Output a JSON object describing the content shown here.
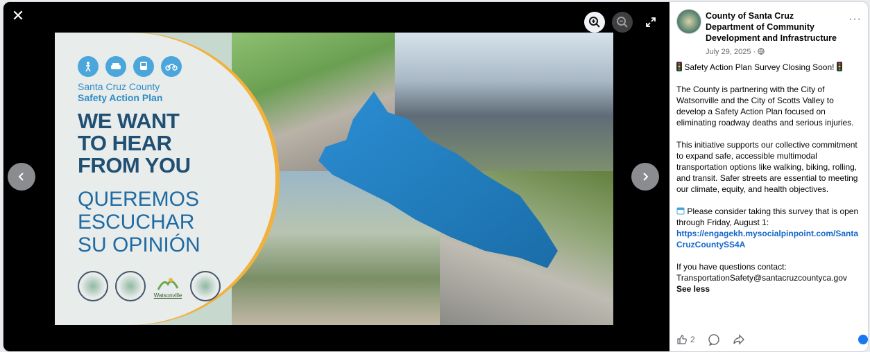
{
  "viewer": {
    "close_icon": "close-icon",
    "zoom_in_icon": "zoom-in-icon",
    "zoom_out_icon": "zoom-out-icon",
    "expand_icon": "expand-icon",
    "prev_icon": "chevron-left-icon",
    "next_icon": "chevron-right-icon"
  },
  "graphic": {
    "brand_line1": "Santa Cruz County",
    "brand_line2": "Safety Action Plan",
    "headline_line1": "WE WANT",
    "headline_line2": "TO HEAR",
    "headline_line3": "FROM YOU",
    "spanish_line1": "QUEREMOS",
    "spanish_line2": "ESCUCHAR",
    "spanish_line3": "SU OPINIÓN",
    "watsonville_label": "Watsonville",
    "colors": {
      "accent_blue": "#2e8cc9",
      "headline_navy": "#1f4f73",
      "orange": "#f2b13c"
    }
  },
  "post": {
    "author": "County of Santa Cruz Department of Community Development and Infrastructure",
    "date": "July 29, 2025 ·",
    "title": "Safety Action Plan Survey Closing Soon!",
    "paragraph1": "The County is partnering with the City of Watsonville and the City of Scotts Valley to develop a Safety Action Plan focused on eliminating roadway deaths and serious injuries.",
    "paragraph2": "This initiative supports our collective commitment to expand safe, accessible multimodal transportation options like walking, biking, rolling, and transit. Safer streets are essential to meeting our climate, equity, and health objectives.",
    "paragraph3": "Please consider taking this survey that is open through Friday, August 1:",
    "link": "https://engagekh.mysocialpinpoint.com/SantaCruzCountySS4A",
    "contact_label": "If you have questions contact:",
    "contact_email": "TransportationSafety@santacruzcountyca.gov",
    "see_less": "See less",
    "like_count": "2"
  }
}
